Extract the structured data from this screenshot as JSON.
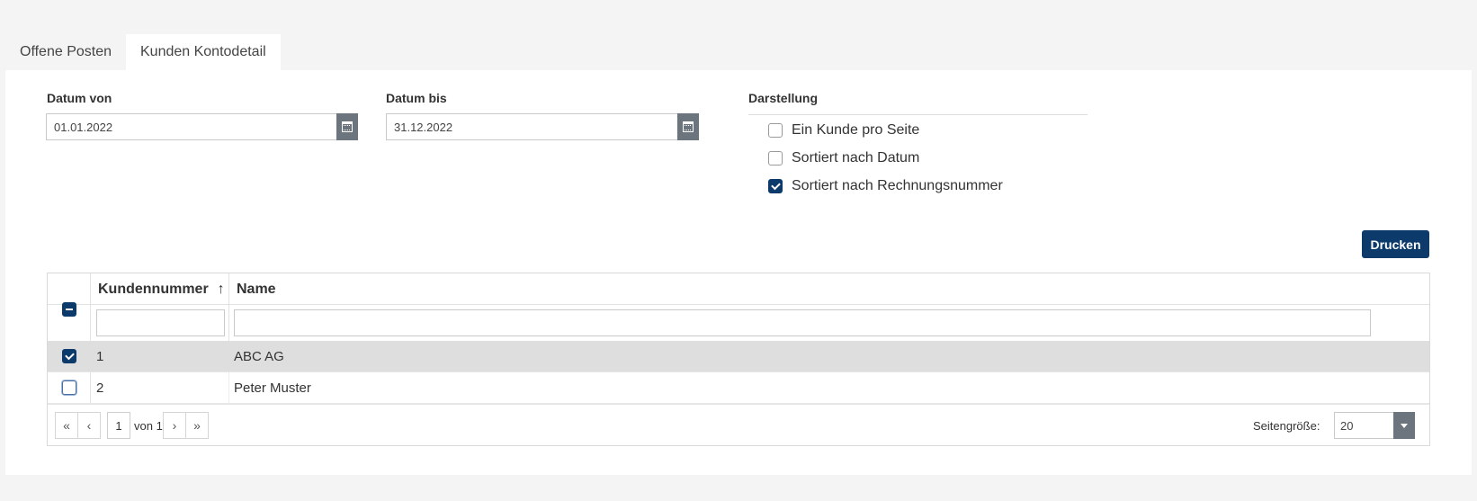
{
  "tabs": [
    {
      "label": "Offene Posten",
      "active": false
    },
    {
      "label": "Kunden Kontodetail",
      "active": true
    }
  ],
  "filters": {
    "datum_von": {
      "label": "Datum von",
      "value": "01.01.2022"
    },
    "datum_bis": {
      "label": "Datum bis",
      "value": "31.12.2022"
    }
  },
  "darstellung": {
    "label": "Darstellung",
    "options": [
      {
        "label": "Ein Kunde pro Seite",
        "checked": false
      },
      {
        "label": "Sortiert nach Datum",
        "checked": false
      },
      {
        "label": "Sortiert nach Rechnungsnummer",
        "checked": true
      }
    ]
  },
  "print_button": "Drucken",
  "grid": {
    "columns": [
      {
        "label": "Kundennummer",
        "sort": "ascending",
        "sort_icon": "arrow-up-icon"
      },
      {
        "label": "Name"
      }
    ],
    "filters": {
      "kundennummer": "",
      "name": ""
    },
    "rows": [
      {
        "kundennummer": "1",
        "name": "ABC AG",
        "selected": true
      },
      {
        "kundennummer": "2",
        "name": "Peter Muster",
        "selected": false
      }
    ],
    "pager": {
      "current_page": "1",
      "of_text": "von 1",
      "page_size_label": "Seitengröße:",
      "page_size": "20"
    }
  },
  "colors": {
    "accent": "#0b3a6b",
    "selected_row": "#dedede",
    "calendar_button": "#6c757d"
  }
}
